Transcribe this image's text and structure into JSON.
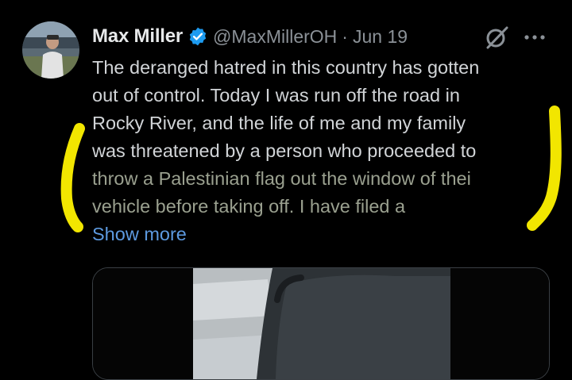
{
  "tweet": {
    "author_name": "Max Miller",
    "handle": "@MaxMillerOH",
    "separator": "·",
    "date": "Jun 19",
    "text_lines": [
      "The deranged hatred in this country has gotten",
      "out of control. Today I was run off the road in",
      "Rocky River, and the life of me and my family",
      "was threatened by a person who proceeded to",
      "throw a Palestinian flag out the window of thei",
      "vehicle before taking off. I have filed a"
    ],
    "show_more": "Show more"
  },
  "icons": {
    "verified": "verified-badge-icon",
    "grok": "grok-icon",
    "more": "more-options-icon"
  },
  "colors": {
    "background": "#000000",
    "text": "#d1d4d7",
    "muted": "#8b9197",
    "link": "#5d9ae0",
    "verified": "#1d9bf0",
    "highlighter": "#f2e600"
  }
}
